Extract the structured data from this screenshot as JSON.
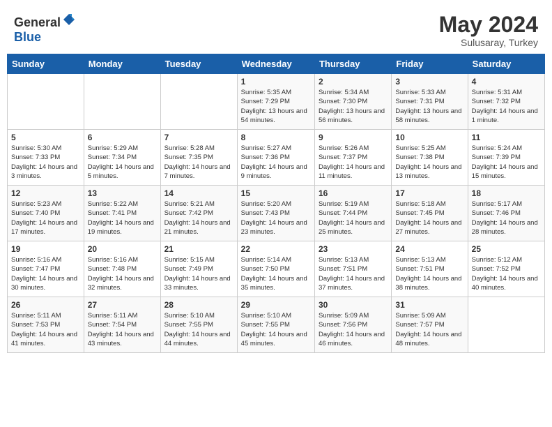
{
  "header": {
    "logo_general": "General",
    "logo_blue": "Blue",
    "month_year": "May 2024",
    "location": "Sulusaray, Turkey"
  },
  "weekdays": [
    "Sunday",
    "Monday",
    "Tuesday",
    "Wednesday",
    "Thursday",
    "Friday",
    "Saturday"
  ],
  "weeks": [
    [
      {
        "day": "",
        "content": ""
      },
      {
        "day": "",
        "content": ""
      },
      {
        "day": "",
        "content": ""
      },
      {
        "day": "1",
        "content": "Sunrise: 5:35 AM\nSunset: 7:29 PM\nDaylight: 13 hours\nand 54 minutes."
      },
      {
        "day": "2",
        "content": "Sunrise: 5:34 AM\nSunset: 7:30 PM\nDaylight: 13 hours\nand 56 minutes."
      },
      {
        "day": "3",
        "content": "Sunrise: 5:33 AM\nSunset: 7:31 PM\nDaylight: 13 hours\nand 58 minutes."
      },
      {
        "day": "4",
        "content": "Sunrise: 5:31 AM\nSunset: 7:32 PM\nDaylight: 14 hours\nand 1 minute."
      }
    ],
    [
      {
        "day": "5",
        "content": "Sunrise: 5:30 AM\nSunset: 7:33 PM\nDaylight: 14 hours\nand 3 minutes."
      },
      {
        "day": "6",
        "content": "Sunrise: 5:29 AM\nSunset: 7:34 PM\nDaylight: 14 hours\nand 5 minutes."
      },
      {
        "day": "7",
        "content": "Sunrise: 5:28 AM\nSunset: 7:35 PM\nDaylight: 14 hours\nand 7 minutes."
      },
      {
        "day": "8",
        "content": "Sunrise: 5:27 AM\nSunset: 7:36 PM\nDaylight: 14 hours\nand 9 minutes."
      },
      {
        "day": "9",
        "content": "Sunrise: 5:26 AM\nSunset: 7:37 PM\nDaylight: 14 hours\nand 11 minutes."
      },
      {
        "day": "10",
        "content": "Sunrise: 5:25 AM\nSunset: 7:38 PM\nDaylight: 14 hours\nand 13 minutes."
      },
      {
        "day": "11",
        "content": "Sunrise: 5:24 AM\nSunset: 7:39 PM\nDaylight: 14 hours\nand 15 minutes."
      }
    ],
    [
      {
        "day": "12",
        "content": "Sunrise: 5:23 AM\nSunset: 7:40 PM\nDaylight: 14 hours\nand 17 minutes."
      },
      {
        "day": "13",
        "content": "Sunrise: 5:22 AM\nSunset: 7:41 PM\nDaylight: 14 hours\nand 19 minutes."
      },
      {
        "day": "14",
        "content": "Sunrise: 5:21 AM\nSunset: 7:42 PM\nDaylight: 14 hours\nand 21 minutes."
      },
      {
        "day": "15",
        "content": "Sunrise: 5:20 AM\nSunset: 7:43 PM\nDaylight: 14 hours\nand 23 minutes."
      },
      {
        "day": "16",
        "content": "Sunrise: 5:19 AM\nSunset: 7:44 PM\nDaylight: 14 hours\nand 25 minutes."
      },
      {
        "day": "17",
        "content": "Sunrise: 5:18 AM\nSunset: 7:45 PM\nDaylight: 14 hours\nand 27 minutes."
      },
      {
        "day": "18",
        "content": "Sunrise: 5:17 AM\nSunset: 7:46 PM\nDaylight: 14 hours\nand 28 minutes."
      }
    ],
    [
      {
        "day": "19",
        "content": "Sunrise: 5:16 AM\nSunset: 7:47 PM\nDaylight: 14 hours\nand 30 minutes."
      },
      {
        "day": "20",
        "content": "Sunrise: 5:16 AM\nSunset: 7:48 PM\nDaylight: 14 hours\nand 32 minutes."
      },
      {
        "day": "21",
        "content": "Sunrise: 5:15 AM\nSunset: 7:49 PM\nDaylight: 14 hours\nand 33 minutes."
      },
      {
        "day": "22",
        "content": "Sunrise: 5:14 AM\nSunset: 7:50 PM\nDaylight: 14 hours\nand 35 minutes."
      },
      {
        "day": "23",
        "content": "Sunrise: 5:13 AM\nSunset: 7:51 PM\nDaylight: 14 hours\nand 37 minutes."
      },
      {
        "day": "24",
        "content": "Sunrise: 5:13 AM\nSunset: 7:51 PM\nDaylight: 14 hours\nand 38 minutes."
      },
      {
        "day": "25",
        "content": "Sunrise: 5:12 AM\nSunset: 7:52 PM\nDaylight: 14 hours\nand 40 minutes."
      }
    ],
    [
      {
        "day": "26",
        "content": "Sunrise: 5:11 AM\nSunset: 7:53 PM\nDaylight: 14 hours\nand 41 minutes."
      },
      {
        "day": "27",
        "content": "Sunrise: 5:11 AM\nSunset: 7:54 PM\nDaylight: 14 hours\nand 43 minutes."
      },
      {
        "day": "28",
        "content": "Sunrise: 5:10 AM\nSunset: 7:55 PM\nDaylight: 14 hours\nand 44 minutes."
      },
      {
        "day": "29",
        "content": "Sunrise: 5:10 AM\nSunset: 7:55 PM\nDaylight: 14 hours\nand 45 minutes."
      },
      {
        "day": "30",
        "content": "Sunrise: 5:09 AM\nSunset: 7:56 PM\nDaylight: 14 hours\nand 46 minutes."
      },
      {
        "day": "31",
        "content": "Sunrise: 5:09 AM\nSunset: 7:57 PM\nDaylight: 14 hours\nand 48 minutes."
      },
      {
        "day": "",
        "content": ""
      }
    ]
  ]
}
